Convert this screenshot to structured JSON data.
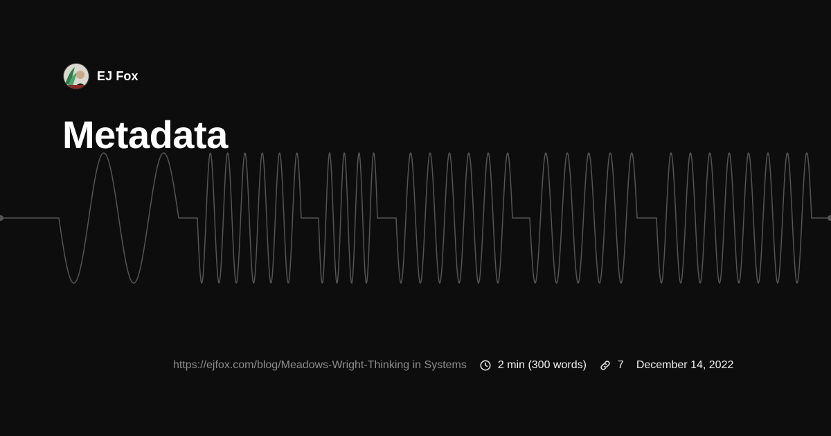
{
  "author": {
    "name": "EJ Fox",
    "avatar_icon": "avatar-illustration-icon"
  },
  "post": {
    "title": "Metadata"
  },
  "meta": {
    "url": "https://ejfox.com/blog/Meadows-Wright-Thinking in Systems",
    "reading_time_icon": "clock-icon",
    "reading_time": "2 min (300 words)",
    "links_icon": "link-icon",
    "links_count": "7",
    "date": "December 14, 2022"
  },
  "waveform": {
    "icon": "morse-waveform-decoration",
    "color": "#555555"
  },
  "colors": {
    "background": "#0d0d0d",
    "text": "#ffffff",
    "muted": "#8c8c8c"
  }
}
